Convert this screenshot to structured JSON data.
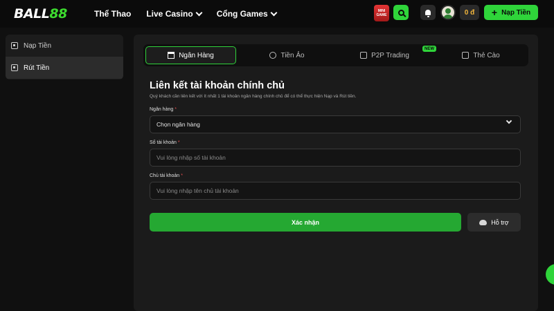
{
  "header": {
    "logo_prefix": "BALL",
    "logo_suffix": "88",
    "nav": [
      {
        "label": "Thể Thao"
      },
      {
        "label": "Live Casino"
      },
      {
        "label": "Cổng Games"
      }
    ],
    "mini_game_line1": "MINI",
    "mini_game_line2": "GAME",
    "balance": "0 đ",
    "deposit_label": "Nạp Tiền",
    "deposit_icon": "plus-icon"
  },
  "sidebar": {
    "items": [
      {
        "label": "Nạp Tiền",
        "icon": "wallet-icon",
        "active": false
      },
      {
        "label": "Rút Tiền",
        "icon": "withdraw-icon",
        "active": true
      }
    ]
  },
  "tabs": [
    {
      "label": "Ngân Hàng",
      "icon": "bank-icon",
      "active": true
    },
    {
      "label": "Tiền Ảo",
      "icon": "coin-icon",
      "active": false
    },
    {
      "label": "P2P Trading",
      "icon": "p2p-icon",
      "active": false,
      "badge": "NEW"
    },
    {
      "label": "Thẻ Cào",
      "icon": "card-icon",
      "active": false
    }
  ],
  "form": {
    "title": "Liên kết tài khoản chính chủ",
    "description": "Quý khách cần liên kết với ít nhất 1 tài khoản ngân hàng chính chủ để có thể thực hiện Nạp và Rút tiền.",
    "bank_label": "Ngân hàng",
    "bank_value": "Chọn ngân hàng",
    "account_number_label": "Số tài khoản",
    "account_number_placeholder": "Vui lòng nhập số tài khoản",
    "account_holder_label": "Chủ tài khoản",
    "account_holder_placeholder": "Vui lòng nhập tên chủ tài khoản",
    "required_mark": "*",
    "submit_label": "Xác nhận",
    "support_label": "Hỗ trợ"
  },
  "colors": {
    "accent": "#2fd43a",
    "submit": "#25a832",
    "balance": "#f2b63c",
    "required": "#e24c4c"
  }
}
